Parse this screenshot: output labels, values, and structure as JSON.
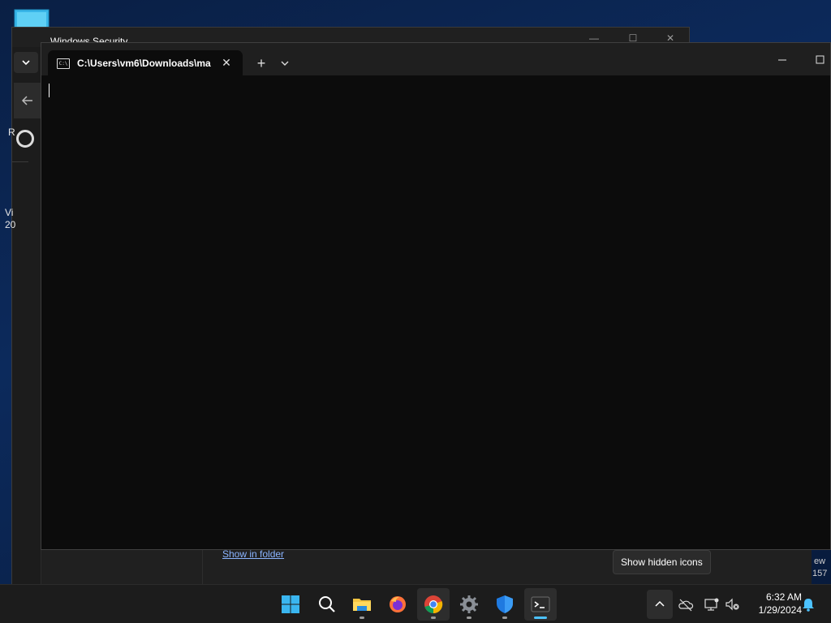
{
  "desktop": {
    "icon_name": "this-pc-icon"
  },
  "windows_security": {
    "title": "Windows Security",
    "menu_icon": "chevron-down-icon",
    "back_icon": "back-arrow-icon",
    "fragment_r": "R",
    "fragment_vi": "Vi",
    "fragment_20": "20",
    "show_in_folder": "Show in folder",
    "fragment_ew": "ew",
    "fragment_157": "157"
  },
  "terminal": {
    "tab_title": "C:\\Users\\vm6\\Downloads\\ma",
    "tab_icon_text": "C:\\",
    "new_tab_label": "+",
    "close_tab_label": "✕"
  },
  "tooltip": {
    "text": "Show hidden icons"
  },
  "taskbar": {
    "apps": [
      "start",
      "search",
      "file-explorer",
      "firefox",
      "chrome",
      "settings",
      "windows-security",
      "terminal"
    ],
    "clock_time": "6:32 AM",
    "clock_date": "1/29/2024"
  },
  "colors": {
    "accent": "#4cc2ff",
    "terminal_bg": "#0c0c0c",
    "taskbar_bg": "#1c1c1c"
  }
}
